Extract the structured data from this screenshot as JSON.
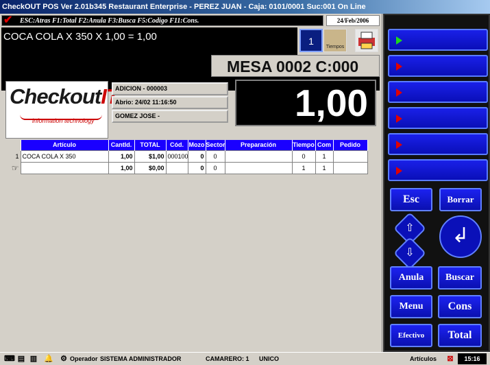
{
  "window": {
    "title": "CheckOUT POS Ver 2.01b345 Restaurant Enterprise - PEREZ JUAN - Caja: 0101/0001 Suc:001  On Line"
  },
  "hotkeys": "ESC:Atras F1:Total F2:Anula F3:Busca F5:Codigo F11:Cons.",
  "date": "24/Feb/2006",
  "display_line": "COCA COLA X 350 X 1,00 = 1,00",
  "top_buttons": {
    "counter": "1",
    "tiempos": "Tiempos"
  },
  "mesa": "MESA 0002 C:000",
  "logo": {
    "brand_a": "Checkout",
    "brand_b": "IT",
    "tagline": "information technology"
  },
  "info": {
    "adicion": "ADICION - 000003",
    "abrio": "Abrio: 24/02 11:16:50",
    "mozo": "GOMEZ JOSE -"
  },
  "total": "1,00",
  "grid": {
    "headers": [
      "Artículo",
      "Cantld.",
      "TOTAL",
      "Cód.",
      "Mozo",
      "Sector",
      "Preparación",
      "Tiempo",
      "Com",
      "Pedido"
    ],
    "rows": [
      {
        "n": "1",
        "articulo": "COCA COLA X 350",
        "cant": "1,00",
        "total": "$1,00",
        "cod": "000100",
        "mozo": "0",
        "sector": "0",
        "prep": "",
        "tiempo": "0",
        "com": "1",
        "pedido": ""
      },
      {
        "n": "",
        "articulo": "",
        "cant": "1,00",
        "total": "$0,00",
        "cod": "",
        "mozo": "0",
        "sector": "0",
        "prep": "",
        "tiempo": "1",
        "com": "1",
        "pedido": ""
      }
    ]
  },
  "keypad": {
    "esc": "Esc",
    "borrar": "Borrar",
    "anula": "Anula",
    "buscar": "Buscar",
    "menu": "Menu",
    "cons": "Cons",
    "efectivo": "Efectivo",
    "total": "Total"
  },
  "status": {
    "operador_label": "Operador",
    "operador": "SISTEMA ADMINISTRADOR",
    "camarero": "CAMARERO: 1",
    "unico": "UNICO",
    "articulos": "Artículos",
    "time": "15:16"
  }
}
